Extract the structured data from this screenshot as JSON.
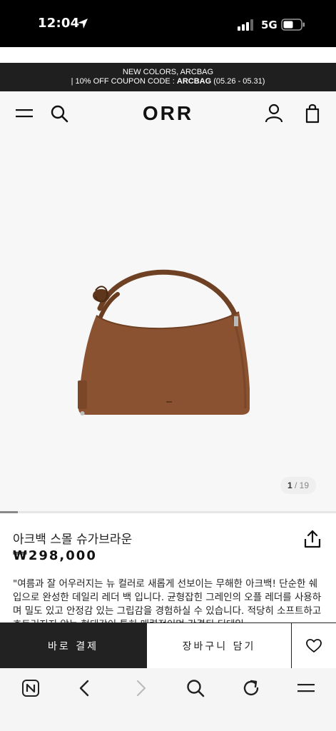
{
  "status_bar": {
    "time": "12:04",
    "network": "5G"
  },
  "promo": {
    "line1": "NEW COLORS, ARCBAG",
    "line2_prefix": "| 10% OFF COUPON CODE : ",
    "line2_code": "ARCBAG",
    "line2_suffix": " (05.26 - 05.31)"
  },
  "header": {
    "logo": "ORR"
  },
  "gallery": {
    "current": "1",
    "separator": " / ",
    "total": "19",
    "progress_fraction": 0.0526
  },
  "product": {
    "name": "아크백 스몰 슈가브라운",
    "price": "₩298,000",
    "description": "\"여름과 잘 어우러지는 뉴 컬러로 새롭게 선보이는 무해한 아크백! 단순한 쉐입으로 완성한 데일리 레더 백 입니다. 균형잡힌 그레인의 오플 레더를 사용하며 밀도 있고 안정감 있는 그립감을 경험하실 수 있습니다. 적당히 소프트하고 흐트러지지 않는 형태감이 특히 매력적이며 간결된 디테일"
  },
  "actions": {
    "buy_now": "바로 결제",
    "add_to_cart": "장바구니 담기"
  },
  "colors": {
    "bag_brown": "#8a5230",
    "dark": "#222222",
    "promo_bg": "#1f1f1f"
  },
  "icons": [
    "location-arrow-icon",
    "signal-icon",
    "battery-icon",
    "menu-icon",
    "search-icon",
    "user-icon",
    "bag-icon",
    "share-icon",
    "heart-icon",
    "naver-icon",
    "back-icon",
    "forward-icon",
    "browser-search-icon",
    "refresh-icon",
    "browser-menu-icon"
  ]
}
